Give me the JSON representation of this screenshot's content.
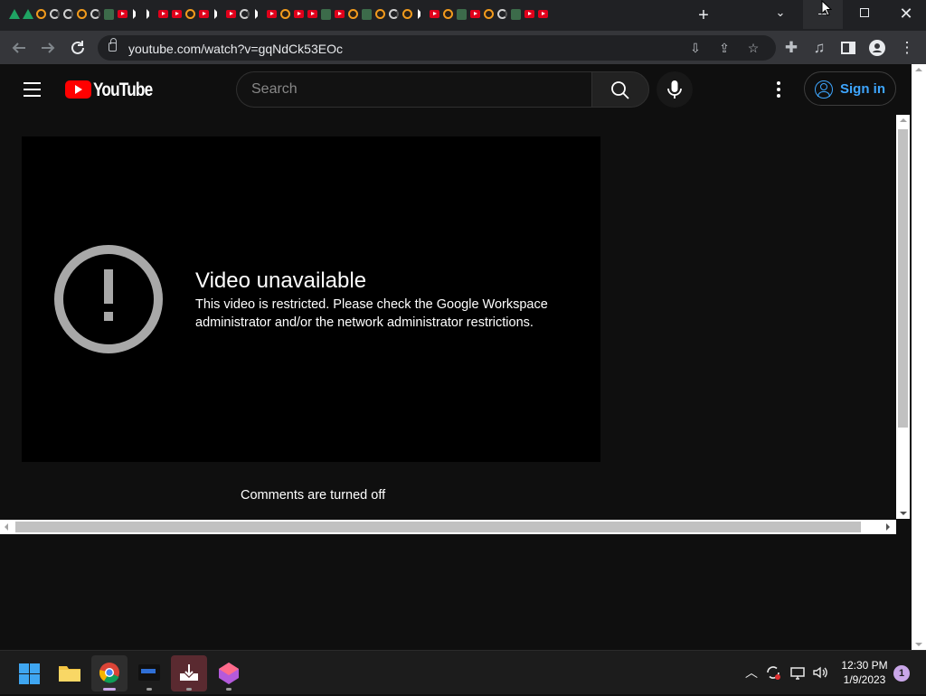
{
  "browser": {
    "tab_favicons": [
      "drive",
      "drive",
      "circle-orange",
      "cycle",
      "cycle",
      "circle-orange",
      "cycle",
      "green",
      "youtube",
      "speaker",
      "speaker",
      "youtube",
      "youtube",
      "circle-orange",
      "youtube",
      "speaker",
      "youtube",
      "cycle",
      "speaker",
      "youtube",
      "circle-orange",
      "youtube",
      "youtube",
      "green",
      "youtube",
      "circle-orange",
      "green",
      "circle-orange",
      "cycle",
      "circle-orange",
      "speaker",
      "youtube",
      "circle-orange",
      "green",
      "youtube",
      "circle-orange",
      "cycle",
      "green",
      "youtube",
      "youtube"
    ],
    "new_tab_label": "+",
    "tab_search_label": "⌄",
    "close_label": "✕",
    "address": "youtube.com/watch?v=gqNdCk53EOc"
  },
  "youtube": {
    "logo_text": "YouTube",
    "search_placeholder": "Search",
    "sign_in_label": "Sign in"
  },
  "player": {
    "error_title": "Video unavailable",
    "error_message": "This video is restricted. Please check the Google Workspace administrator and/or the network administrator restrictions."
  },
  "comments_text": "Comments are turned off",
  "taskbar": {
    "time": "12:30 PM",
    "date": "1/9/2023",
    "notification_count": "1"
  },
  "colors": {
    "page_bg": "#0f0f0f",
    "youtube_red": "#ff0000",
    "link_blue": "#3ea6ff"
  }
}
